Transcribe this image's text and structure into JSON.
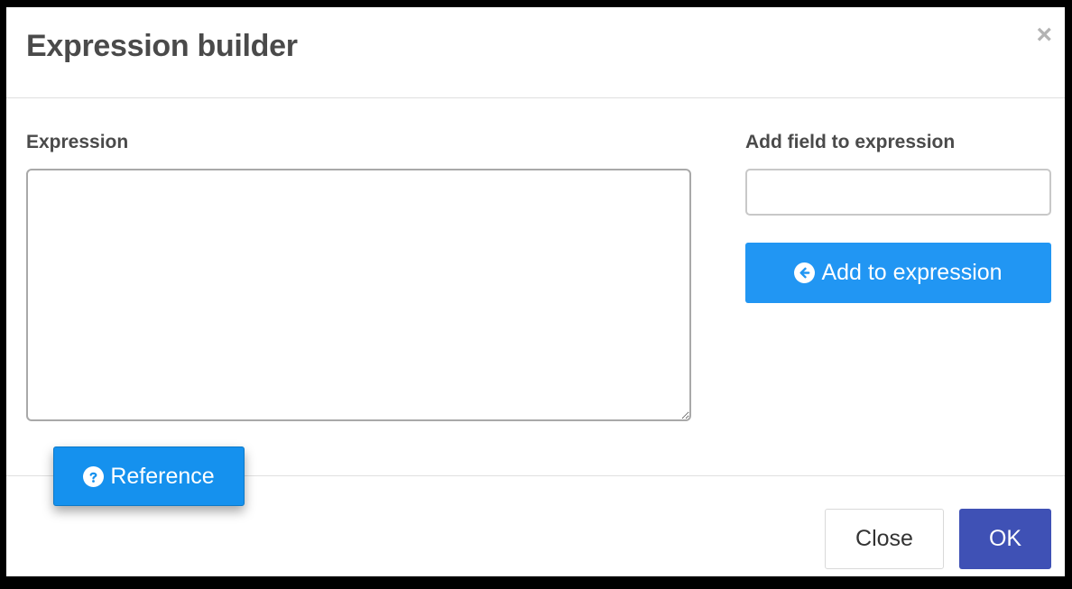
{
  "dialog": {
    "title": "Expression builder",
    "close_symbol": "×"
  },
  "expression": {
    "label": "Expression",
    "value": ""
  },
  "add_field": {
    "label": "Add field to expression",
    "value": "",
    "button_label": "Add to expression",
    "button_icon": "arrow-circle-left-icon"
  },
  "reference": {
    "button_label": "Reference",
    "button_icon": "question-circle-icon"
  },
  "footer": {
    "close_label": "Close",
    "ok_label": "OK"
  },
  "colors": {
    "primary": "#2196f3",
    "reference": "#1591ee",
    "ok": "#3f51b5"
  }
}
